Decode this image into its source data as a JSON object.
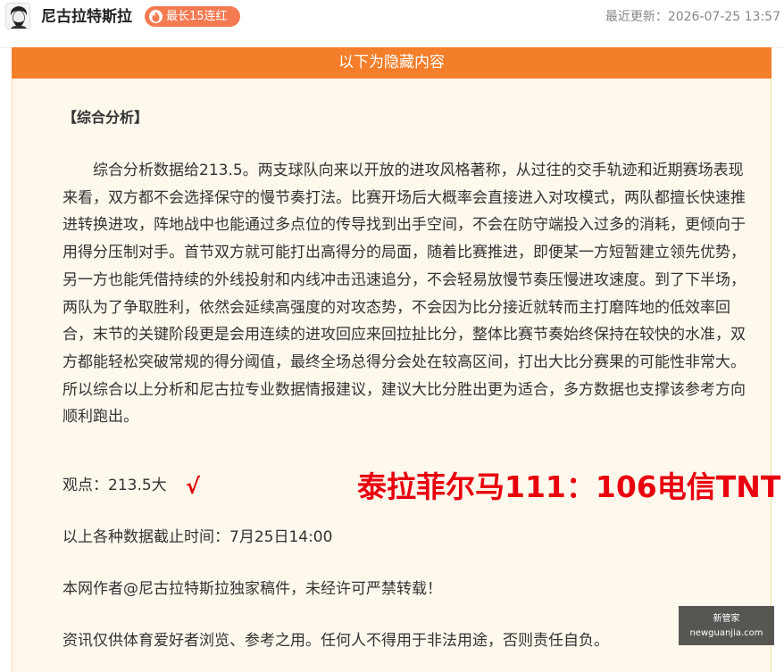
{
  "header": {
    "author": "尼古拉特斯拉",
    "streak_badge": "最长15连红",
    "last_updated": "最近更新：2026-07-25 13:57"
  },
  "hidden_section": {
    "banner": "以下为隐藏内容",
    "section_title": "【综合分析】",
    "paragraph": "　　综合分析数据给213.5。两支球队向来以开放的进攻风格著称，从过往的交手轨迹和近期赛场表现来看，双方都不会选择保守的慢节奏打法。比赛开场后大概率会直接进入对攻模式，两队都擅长快速推进转换进攻，阵地战中也能通过多点位的传导找到出手空间，不会在防守端投入过多的消耗，更倾向于用得分压制对手。首节双方就可能打出高得分的局面，随着比赛推进，即便某一方短暂建立领先优势，另一方也能凭借持续的外线投射和内线冲击迅速追分，不会轻易放慢节奏压慢进攻速度。到了下半场，两队为了争取胜利，依然会延续高强度的对攻态势，不会因为比分接近就转而主打磨阵地的低效率回合，末节的关键阶段更是会用连续的进攻回应来回拉扯比分，整体比赛节奏始终保持在较快的水准，双方都能轻松突破常规的得分阈值，最终全场总得分会处在较高区间，打出大比分赛果的可能性非常大。所以综合以上分析和尼古拉专业数据情报建议，建议大比分胜出更为适合，多方数据也支撑该参考方向顺利跑出。",
    "viewpoint": "观点：213.5大",
    "check_mark": "√",
    "result": "泰拉菲尔马111：106电信TNT",
    "data_cutoff": "以上各种数据截止时间：7月25日14:00",
    "copyright": "本网作者@尼古拉特斯拉独家稿件，未经许可严禁转载！",
    "disclaimer": "资讯仅供体育爱好者浏览、参考之用。任何人不得用于非法用途，否则责任自负。"
  },
  "watermark": {
    "line1": "新管家",
    "line2": "newguanjia.com"
  },
  "colors": {
    "banner": "#f47e2a",
    "badge": "#f47a52",
    "result_red": "#e8000f",
    "box_bg": "#fff8ec"
  }
}
